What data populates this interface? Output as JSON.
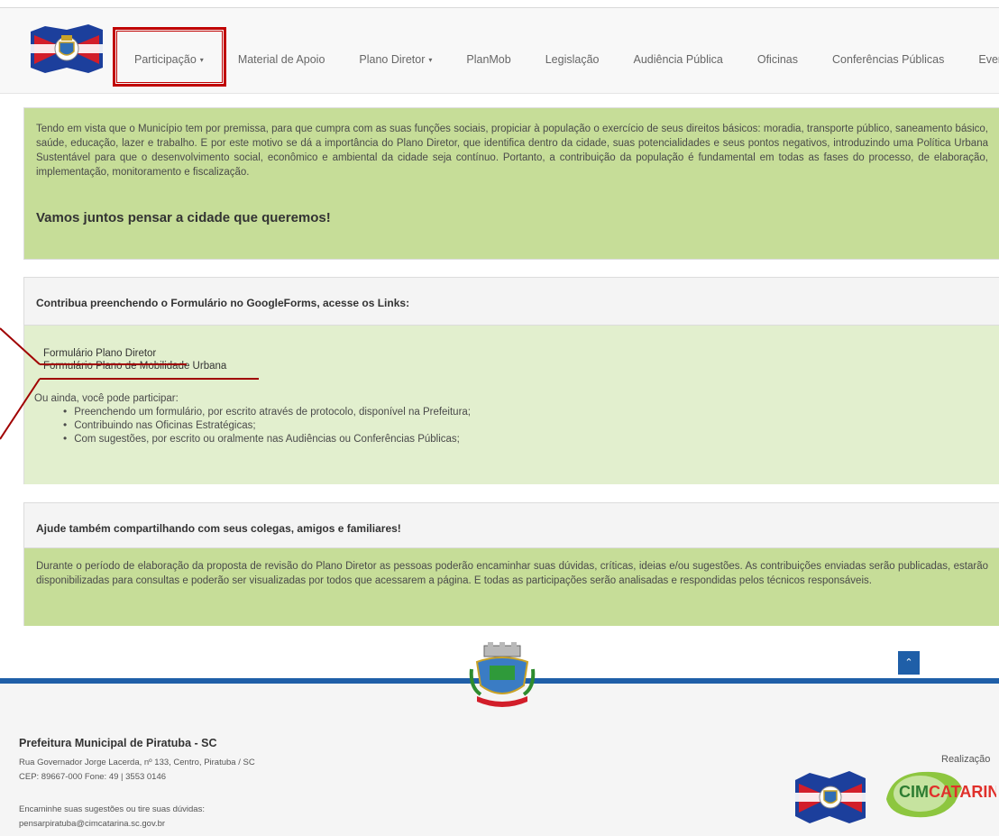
{
  "nav": {
    "items": [
      {
        "label": "Participação",
        "caret": "▾"
      },
      {
        "label": "Material de Apoio"
      },
      {
        "label": "Plano Diretor",
        "caret": "▾"
      },
      {
        "label": "PlanMob"
      },
      {
        "label": "Legislação"
      },
      {
        "label": "Audiência Pública"
      },
      {
        "label": "Oficinas"
      },
      {
        "label": "Conferências Públicas"
      },
      {
        "label": "Eventos"
      }
    ]
  },
  "intro": {
    "text": "Tendo em vista que o Município tem por premissa, para que cumpra com as suas funções sociais, propiciar à população o exercício de seus direitos básicos: moradia, transporte público, saneamento básico, saúde, educação, lazer e trabalho. E por este motivo se dá a importância do Plano Diretor, que identifica dentro da cidade, suas potencialidades e seus pontos negativos, introduzindo uma Política Urbana Sustentável para que o desenvolvimento social, econômico e ambiental da cidade seja contínuo. Portanto, a contribuição da população é fundamental em todas as fases do processo, de elaboração, implementação, monitoramento e fiscalização.",
    "heading": "Vamos juntos pensar a cidade que queremos!"
  },
  "forms": {
    "heading": "Contribua preenchendo o Formulário no GoogleForms, acesse os Links:",
    "link1": "Formulário Plano Diretor",
    "link2": "Formulário Plano de Mobilidade Urbana",
    "more": "Ou ainda, você pode participar:",
    "bullets": [
      "Preenchendo um formulário, por escrito através de protocolo, disponível na Prefeitura;",
      "Contribuindo nas Oficinas Estratégicas;",
      "Com sugestões, por escrito ou oralmente nas Audiências ou Conferências Públicas;"
    ]
  },
  "share": {
    "heading": "Ajude também compartilhando com seus colegas, amigos e familiares!",
    "text": "Durante o período de elaboração da proposta de revisão do Plano Diretor as pessoas poderão encaminhar suas dúvidas, críticas, ideias e/ou sugestões. As contribuições enviadas serão publicadas, estarão disponibilizadas para consultas e poderão ser visualizadas por todos que acessarem a página. E todas as participações serão analisadas e respondidas pelos técnicos responsáveis."
  },
  "footer": {
    "title": "Prefeitura Municipal de Piratuba - SC",
    "address": "Rua Governador Jorge Lacerda, nº 133, Centro, Piratuba / SC",
    "contact": "CEP: 89667-000  Fone: 49 | 3553 0146",
    "suggest": "Encaminhe suas sugestões ou tire suas dúvidas:",
    "email": "pensarpiratuba@cimcatarina.sc.gov.br",
    "realizacao": "Realização",
    "cim_logo_text": "CIMCATARINA",
    "to_top": "⌃"
  },
  "colors": {
    "accent_red": "#c00000",
    "footer_blue": "#1f5fa8",
    "green_panel": "#c6dd98",
    "light_green_panel": "#e2efce"
  }
}
